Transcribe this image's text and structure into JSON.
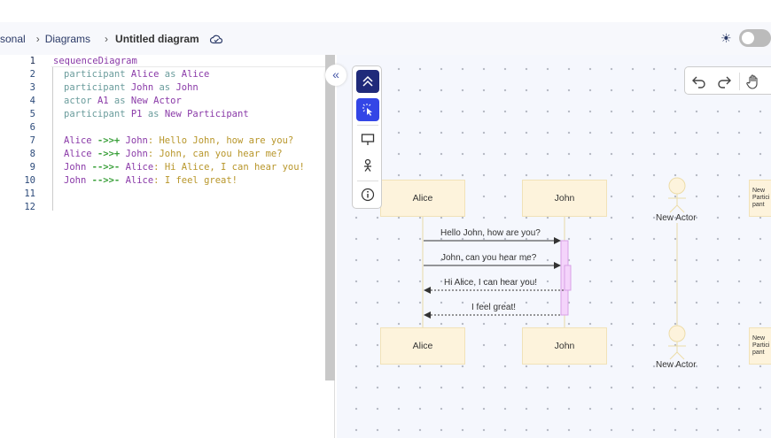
{
  "breadcrumb": {
    "items": [
      "sonal",
      "Diagrams",
      "Untitled diagram"
    ]
  },
  "editor": {
    "lines": [
      "1",
      "2",
      "3",
      "4",
      "5",
      "6",
      "7",
      "8",
      "9",
      "10",
      "11",
      "12"
    ]
  },
  "code": {
    "l1": "sequenceDiagram",
    "l2": [
      "participant ",
      "Alice",
      " as ",
      "Alice"
    ],
    "l3": [
      "participant ",
      "John",
      " as ",
      "John"
    ],
    "l4": [
      "actor ",
      "A1",
      " as ",
      "New Actor"
    ],
    "l5": [
      "participant ",
      "P1",
      " as ",
      "New Participant"
    ],
    "l7": [
      "Alice",
      " ->>+ ",
      "John",
      ": Hello John, how are you?"
    ],
    "l8": [
      "Alice",
      " ->>+ ",
      "John",
      ": John, can you hear me?"
    ],
    "l9": [
      "John",
      " -->>- ",
      "Alice",
      ": Hi Alice, I can hear you!"
    ],
    "l10": [
      "John",
      " -->>- ",
      "Alice",
      ": I feel great!"
    ]
  },
  "diagram": {
    "participants": [
      "Alice",
      "John",
      "New Actor",
      "New Participant"
    ],
    "messages": [
      "Hello John, how are you?",
      "John, can you hear me?",
      "Hi Alice, I can hear you!",
      "I feel great!"
    ],
    "colors": {
      "box": "#fdf3dc",
      "activation": "#f4d4fb"
    }
  }
}
